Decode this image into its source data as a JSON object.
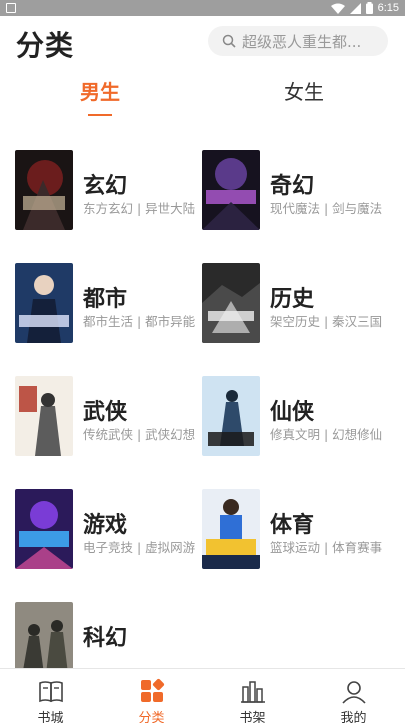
{
  "status_bar": {
    "time": "6:15"
  },
  "header": {
    "title": "分类",
    "search": {
      "placeholder": "超级恶人重生都..."
    }
  },
  "gender_tabs": [
    {
      "label": "男生",
      "active": true
    },
    {
      "label": "女生",
      "active": false
    }
  ],
  "categories": [
    {
      "name": "玄幻",
      "sub": "东方玄幻 | 异世大陆"
    },
    {
      "name": "奇幻",
      "sub": "现代魔法 | 剑与魔法"
    },
    {
      "name": "都市",
      "sub": "都市生活 | 都市异能"
    },
    {
      "name": "历史",
      "sub": "架空历史 | 秦汉三国"
    },
    {
      "name": "武侠",
      "sub": "传统武侠 | 武侠幻想"
    },
    {
      "name": "仙侠",
      "sub": "修真文明 | 幻想修仙"
    },
    {
      "name": "游戏",
      "sub": "电子竞技 | 虚拟网游"
    },
    {
      "name": "体育",
      "sub": "篮球运动 | 体育赛事"
    },
    {
      "name": "科幻",
      "sub": ""
    }
  ],
  "bottom_nav": [
    {
      "label": "书城",
      "icon": "book-open-icon",
      "active": false
    },
    {
      "label": "分类",
      "icon": "category-grid-icon",
      "active": true
    },
    {
      "label": "书架",
      "icon": "bookshelf-icon",
      "active": false
    },
    {
      "label": "我的",
      "icon": "profile-icon",
      "active": false
    }
  ],
  "colors": {
    "accent": "#f06a2a",
    "muted": "#999999",
    "status_bar": "#9e9e9e"
  }
}
